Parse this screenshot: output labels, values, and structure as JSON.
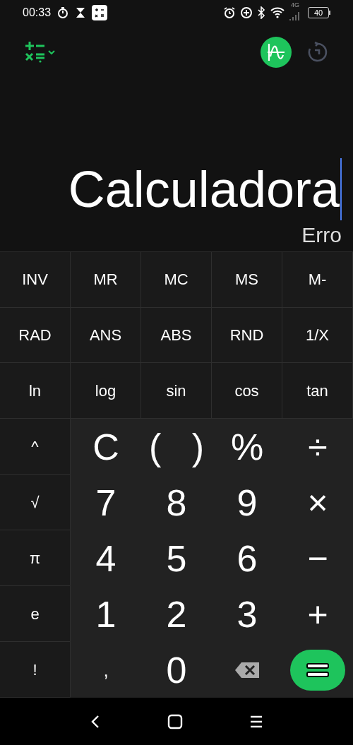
{
  "status_bar": {
    "time": "00:33",
    "network": "4G",
    "battery": "40"
  },
  "display": {
    "expression": "Calculadora",
    "result": "Erro"
  },
  "function_keys": [
    "INV",
    "MR",
    "MC",
    "MS",
    "M-",
    "RAD",
    "ANS",
    "ABS",
    "RND",
    "1/X",
    "ln",
    "log",
    "sin",
    "cos",
    "tan"
  ],
  "side_keys": [
    "^",
    "√",
    "π",
    "e",
    "!"
  ],
  "number_pad": [
    {
      "kind": "text",
      "label": "C"
    },
    {
      "kind": "text",
      "label": "(   )"
    },
    {
      "kind": "text",
      "label": "%"
    },
    {
      "kind": "operator",
      "label": "÷"
    },
    {
      "kind": "text",
      "label": "7"
    },
    {
      "kind": "text",
      "label": "8"
    },
    {
      "kind": "text",
      "label": "9"
    },
    {
      "kind": "operator",
      "label": "×"
    },
    {
      "kind": "text",
      "label": "4"
    },
    {
      "kind": "text",
      "label": "5"
    },
    {
      "kind": "text",
      "label": "6"
    },
    {
      "kind": "operator",
      "label": "−"
    },
    {
      "kind": "text",
      "label": "1"
    },
    {
      "kind": "text",
      "label": "2"
    },
    {
      "kind": "text",
      "label": "3"
    },
    {
      "kind": "operator",
      "label": "+"
    },
    {
      "kind": "small",
      "label": ","
    },
    {
      "kind": "text",
      "label": "0"
    },
    {
      "kind": "backspace"
    },
    {
      "kind": "equals"
    }
  ]
}
